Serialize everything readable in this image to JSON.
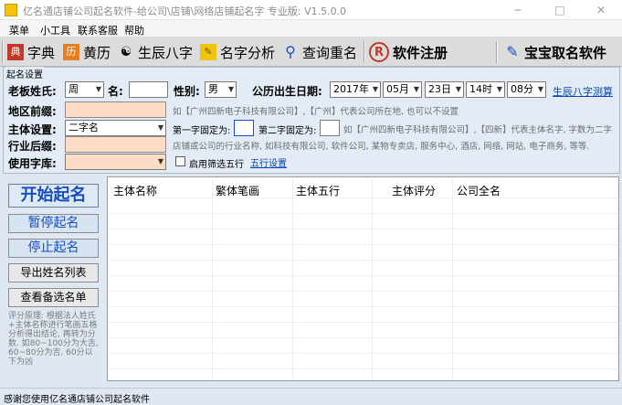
{
  "window": {
    "title": "亿名通店铺公司起名软件-给公司\\店铺\\网络店铺起名字  专业版: V1.5.0.0",
    "minimize": "─",
    "maximize": "□",
    "close": "✕"
  },
  "menu": [
    "菜单",
    "小工具",
    "联系客服",
    "帮助"
  ],
  "toolbar": [
    {
      "label": "字典",
      "icon": "book-icon"
    },
    {
      "label": "黄历",
      "icon": "almanac-icon"
    },
    {
      "label": "生辰八字",
      "icon": "yinyang-icon"
    },
    {
      "label": "名字分析",
      "icon": "notepad-icon"
    },
    {
      "label": "查询重名",
      "icon": "magnifier-icon"
    },
    {
      "label": "软件注册",
      "icon": "registered-icon"
    },
    {
      "label": "宝宝取名软件",
      "icon": "baby-icon"
    }
  ],
  "settings": {
    "group_label": "起名设置",
    "surname_label": "老板姓氏:",
    "surname_value": "周",
    "name_label": "名:",
    "name_value": "",
    "gender_label": "性别:",
    "gender_value": "男",
    "birth_label": "公历出生日期:",
    "year": "2017年",
    "month": "05月",
    "day": "23日",
    "hour": "14时",
    "minute": "08分",
    "bazi_link": "生辰八字测算",
    "region_label": "地区前缀:",
    "region_value": "",
    "region_hint": "如【广州四新电子科技有限公司】,【广州】代表公司所在地, 也可以不设置",
    "main_label": "主体设置:",
    "main_value": "二字名",
    "first_fixed_label": "第一字固定为:",
    "first_fixed_value": "",
    "second_fixed_label": "第二字固定为:",
    "second_fixed_value": "",
    "main_hint": "如【广州四新电子科技有限公司】,【四新】代表主体名字, 字数为二字",
    "suffix_label": "行业后缀:",
    "suffix_value": "",
    "suffix_hint": "店铺或公司的行业名称, 如科技有限公司, 软件公司, 某物专卖店, 服务中心, 酒店, 网络, 网站, 电子商务, 等等.",
    "charset_label": "使用字库:",
    "charset_value": "",
    "wuxing_checkbox_label": "启用筛选五行",
    "wuxing_link": "五行设置"
  },
  "actions": {
    "start": "开始起名",
    "pause": "暂停起名",
    "stop": "停止起名",
    "export": "导出姓名列表",
    "view": "查看备选名单"
  },
  "score_note": "评分原理: 根据法人姓氏+主体名称进行笔画五格分析得出结论, 再转为分数. 如80~100分为大吉, 60~80分为吉, 60分以下为凶",
  "grid": {
    "columns": [
      "主体名称",
      "繁体笔画",
      "主体五行",
      "主体评分",
      "公司全名"
    ],
    "rows": []
  },
  "status": "感谢您使用亿名通店铺公司起名软件"
}
